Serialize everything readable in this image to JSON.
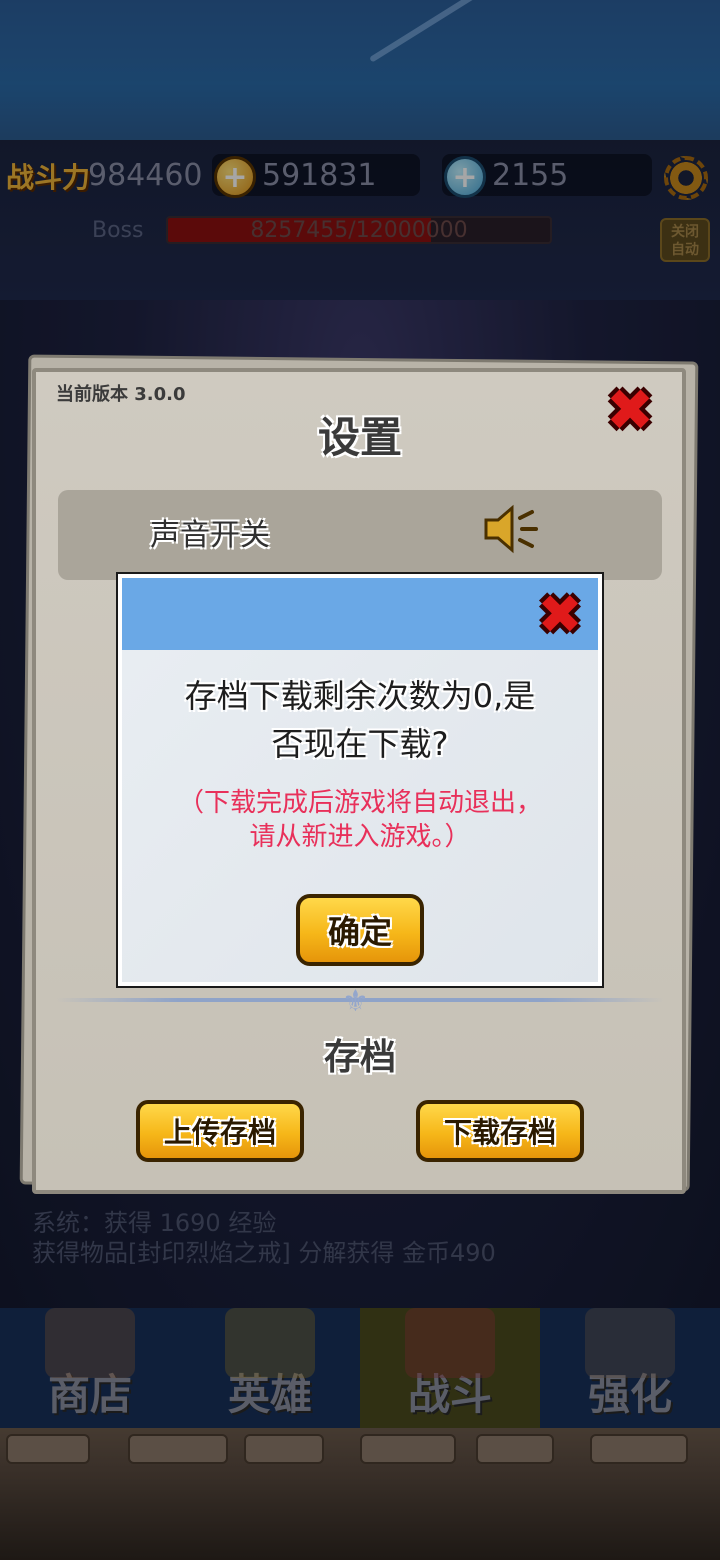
{
  "topbar": {
    "power_label": "战斗力",
    "power_value": "984460",
    "gold_value": "591831",
    "gem_value": "2155",
    "plus_glyph": "+",
    "settings_icon": "gear-icon"
  },
  "boss": {
    "label": "Boss",
    "hp_text": "8257455/12000000",
    "hp_fraction": 0.688
  },
  "autofight": {
    "label_line1": "关闭",
    "label_line2": "自动"
  },
  "log": {
    "lines": [
      "系统：获得 1690 经验",
      "获得物品[封印烈焰之戒] 分解获得 金币490"
    ]
  },
  "nav": {
    "tabs": [
      {
        "label": "商店",
        "icon": "shop-icon"
      },
      {
        "label": "英雄",
        "icon": "hero-icon"
      },
      {
        "label": "战斗",
        "icon": "battle-icon"
      },
      {
        "label": "强化",
        "icon": "forge-icon"
      }
    ],
    "active_index": 2
  },
  "settings": {
    "version": "当前版本 3.0.0",
    "title": "设置",
    "close_glyph": "✖",
    "sound_label": "声音开关",
    "sound_icon": "speaker-icon",
    "save_section_title": "存档",
    "upload_label": "上传存档",
    "download_label": "下载存档",
    "divider_glyph": "⚜"
  },
  "dialog": {
    "message_line1": "存档下载剩余次数为0,是",
    "message_line2": "否现在下载?",
    "note_line1": "（下载完成后游戏将自动退出，",
    "note_line2": "请从新进入游戏。）",
    "confirm_label": "确定",
    "close_glyph": "✖",
    "header_color": "#6aa8e6",
    "note_color": "#e8305a"
  }
}
